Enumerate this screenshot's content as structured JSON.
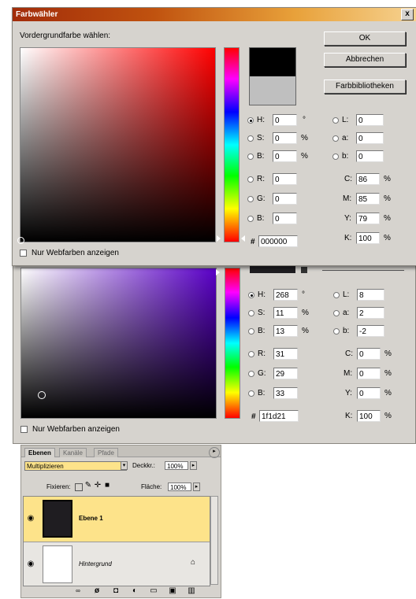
{
  "dialog_top": {
    "title": "Farbwähler",
    "close_glyph": "x",
    "prompt": "Vordergrundfarbe wählen:",
    "ok_label": "OK",
    "cancel_label": "Abbrechen",
    "library_label": "Farbbibliotheken",
    "new_color": "#000000",
    "current_color": "#bfbfbf",
    "webonly_label": "Nur Webfarben anzeigen",
    "fields": {
      "H": {
        "label": "H:",
        "value": "0",
        "unit": "°"
      },
      "S": {
        "label": "S:",
        "value": "0",
        "unit": "%"
      },
      "Bv": {
        "label": "B:",
        "value": "0",
        "unit": "%"
      },
      "R": {
        "label": "R:",
        "value": "0"
      },
      "G": {
        "label": "G:",
        "value": "0"
      },
      "B": {
        "label": "B:",
        "value": "0"
      },
      "L": {
        "label": "L:",
        "value": "0"
      },
      "a": {
        "label": "a:",
        "value": "0"
      },
      "b": {
        "label": "b:",
        "value": "0"
      },
      "C": {
        "label": "C:",
        "value": "86",
        "unit": "%"
      },
      "M": {
        "label": "M:",
        "value": "85",
        "unit": "%"
      },
      "Y": {
        "label": "Y:",
        "value": "79",
        "unit": "%"
      },
      "K": {
        "label": "K:",
        "value": "100",
        "unit": "%"
      },
      "hex_label": "#",
      "hex": "000000"
    }
  },
  "dialog_bottom": {
    "webonly_label": "Nur Webfarben anzeigen",
    "fields": {
      "H": {
        "label": "H:",
        "value": "268",
        "unit": "°"
      },
      "S": {
        "label": "S:",
        "value": "11",
        "unit": "%"
      },
      "Bv": {
        "label": "B:",
        "value": "13",
        "unit": "%"
      },
      "R": {
        "label": "R:",
        "value": "31"
      },
      "G": {
        "label": "G:",
        "value": "29"
      },
      "B": {
        "label": "B:",
        "value": "33"
      },
      "L": {
        "label": "L:",
        "value": "8"
      },
      "a": {
        "label": "a:",
        "value": "2"
      },
      "b": {
        "label": "b:",
        "value": "-2"
      },
      "C": {
        "label": "C:",
        "value": "0",
        "unit": "%"
      },
      "M": {
        "label": "M:",
        "value": "0",
        "unit": "%"
      },
      "Y": {
        "label": "Y:",
        "value": "0",
        "unit": "%"
      },
      "K": {
        "label": "K:",
        "value": "100",
        "unit": "%"
      },
      "hex_label": "#",
      "hex": "1f1d21"
    }
  },
  "layers_panel": {
    "tabs": [
      "Ebenen",
      "Kanäle",
      "Pfade"
    ],
    "blend_mode": "Multiplizieren",
    "opacity_label": "Deckkr.:",
    "opacity_value": "100%",
    "lock_label": "Fixieren:",
    "fill_label": "Fläche:",
    "fill_value": "100%",
    "layers": [
      {
        "name": "Ebene 1",
        "selected": true,
        "thumb": "#1f1d21"
      },
      {
        "name": "Hintergrund",
        "selected": false,
        "thumb": "#ffffff"
      }
    ],
    "icons": [
      "link-icon",
      "fx-icon",
      "mask-icon",
      "adjustment-icon",
      "folder-icon",
      "new-layer-icon",
      "trash-icon"
    ]
  }
}
